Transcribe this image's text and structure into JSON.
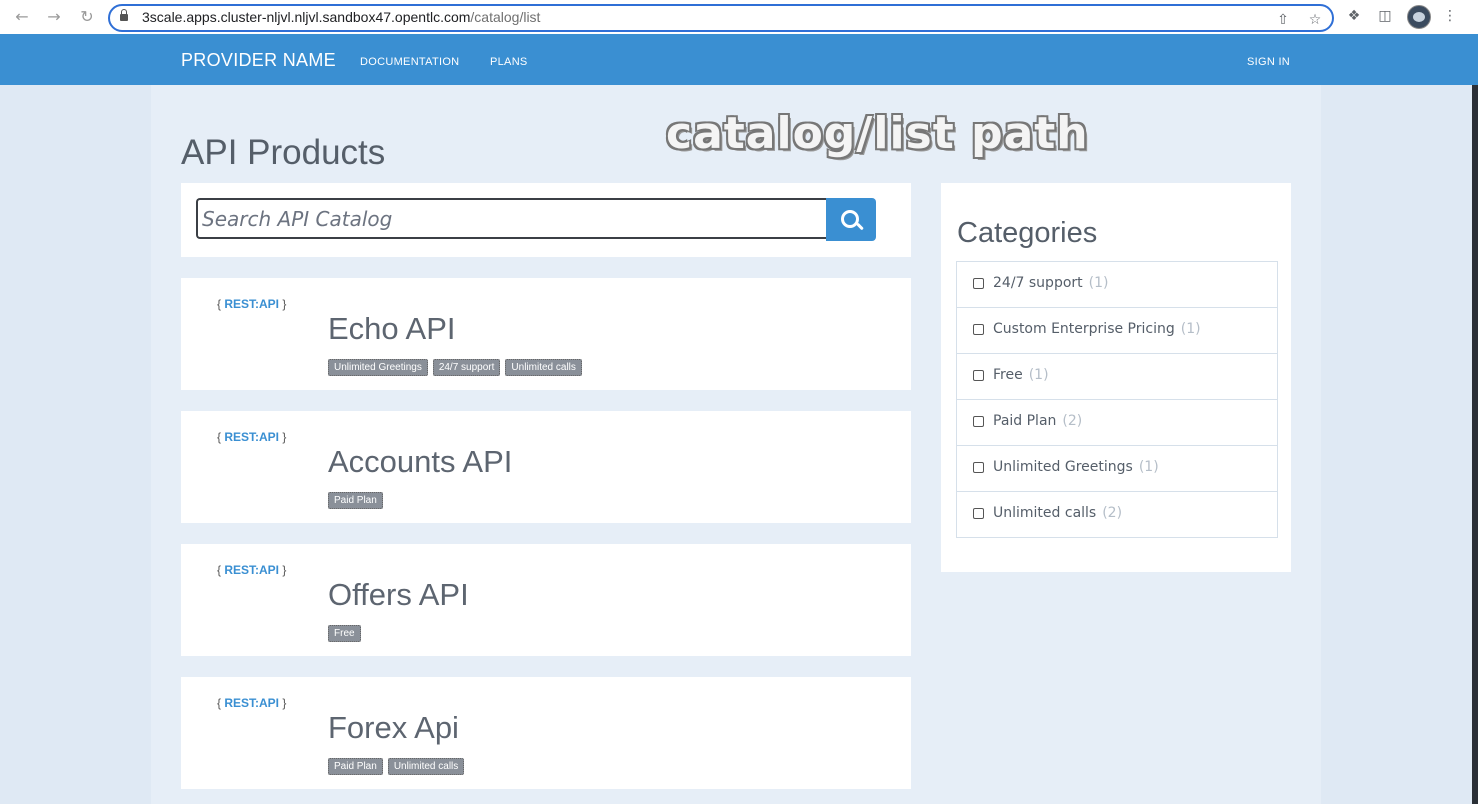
{
  "browser": {
    "url_main": "3scale.apps.cluster-nljvl.nljvl.sandbox47.",
    "url_host_rest": "opentlc.com",
    "url_path": "/catalog/list"
  },
  "nav": {
    "brand": "PROVIDER NAME",
    "links": [
      "DOCUMENTATION",
      "PLANS"
    ],
    "sign_in": "SIGN IN"
  },
  "page": {
    "title": "API Products",
    "overlay_caption": "catalog/list path"
  },
  "search": {
    "placeholder": "Search API Catalog",
    "icon": "search-icon"
  },
  "apis": [
    {
      "logo": "REST:API",
      "name": "Echo API",
      "tags": [
        "Unlimited Greetings",
        "24/7 support",
        "Unlimited calls"
      ]
    },
    {
      "logo": "REST:API",
      "name": "Accounts API",
      "tags": [
        "Paid Plan"
      ]
    },
    {
      "logo": "REST:API",
      "name": "Offers API",
      "tags": [
        "Free"
      ]
    },
    {
      "logo": "REST:API",
      "name": "Forex Api",
      "tags": [
        "Paid Plan",
        "Unlimited calls"
      ]
    }
  ],
  "categories": {
    "title": "Categories",
    "items": [
      {
        "label": "24/7 support",
        "count": "(1)"
      },
      {
        "label": "Custom Enterprise Pricing",
        "count": "(1)"
      },
      {
        "label": "Free",
        "count": "(1)"
      },
      {
        "label": "Paid Plan",
        "count": "(2)"
      },
      {
        "label": "Unlimited Greetings",
        "count": "(1)"
      },
      {
        "label": "Unlimited calls",
        "count": "(2)"
      }
    ]
  },
  "colors": {
    "accent": "#3a8fd2",
    "background": "#dfe9f4",
    "tag": "#8a9099"
  }
}
